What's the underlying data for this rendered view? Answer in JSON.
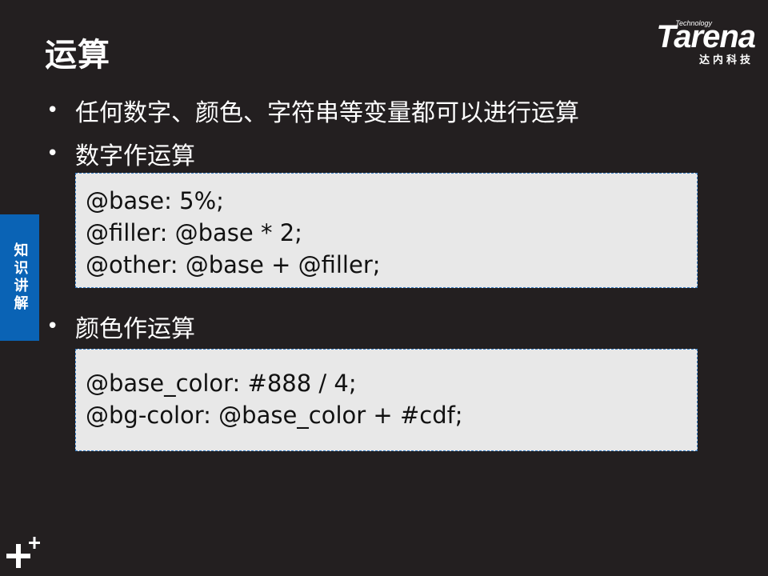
{
  "slide": {
    "title": "运算",
    "logo": {
      "tech": "Technology",
      "word": "Tarena",
      "subtitle": "达内科技"
    },
    "side_tab": "知识讲解",
    "bullets": [
      "任何数字、颜色、字符串等变量都可以进行运算",
      "数字作运算",
      "颜色作运算"
    ],
    "code_blocks": [
      [
        "@base: 5%;",
        "@filler: @base * 2;",
        "@other: @base + @filler;"
      ],
      [
        "@base_color: #888 / 4;",
        "@bg-color: @base_color + #cdf;"
      ]
    ],
    "colors": {
      "background": "#231f20",
      "accent": "#0a63b5",
      "code_bg": "#e8e8e8"
    },
    "icons": [
      "bullet-dot-icon",
      "plus-mark-icon"
    ]
  }
}
